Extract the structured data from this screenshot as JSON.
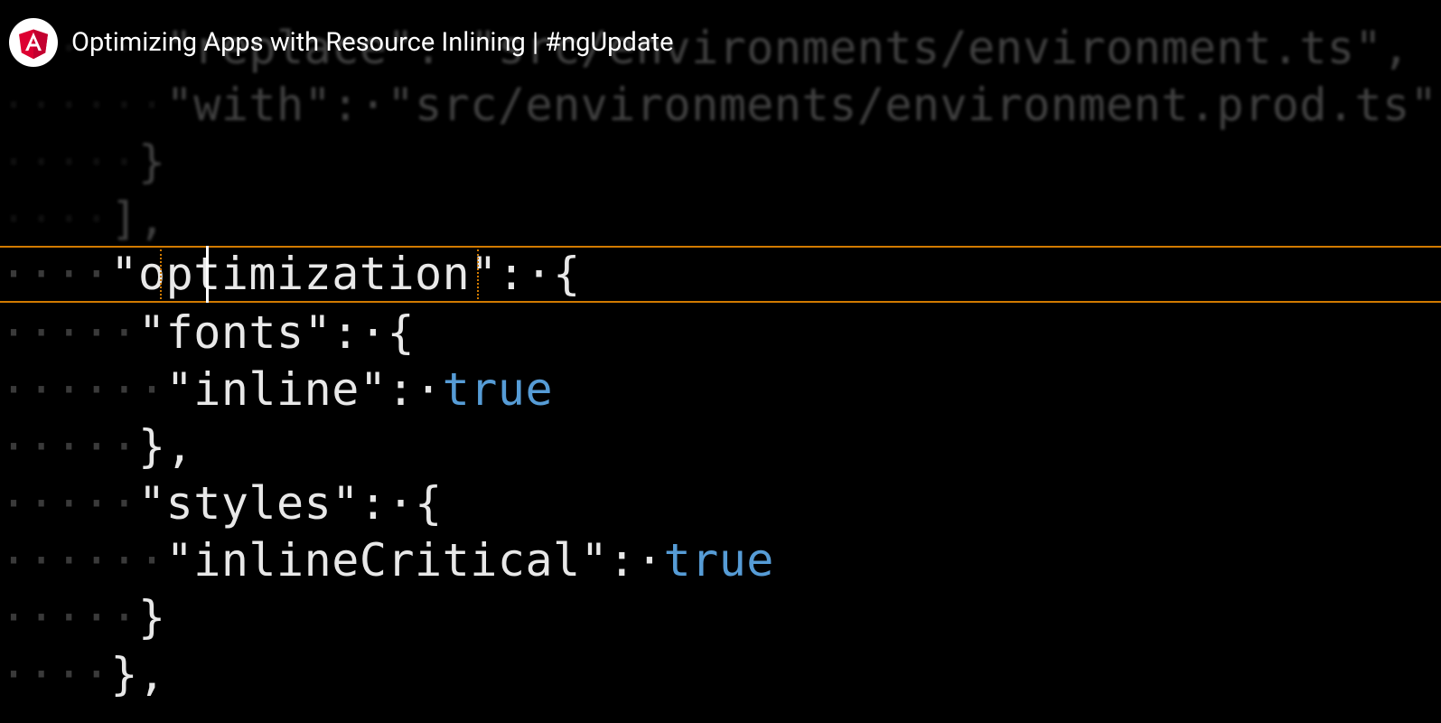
{
  "title": "Optimizing Apps with Resource Inlining | #ngUpdate",
  "colors": {
    "angular_red": "#DD0031",
    "boolean": "#569cd6",
    "highlight_border": "#d17a00"
  },
  "code": {
    "line0": {
      "indent": "······",
      "content": "\"replace\": \"src/environments/environment.ts\","
    },
    "line1": {
      "indent": "······",
      "key": "\"with\"",
      "value": "\"src/environments/environment.prod.ts\""
    },
    "line2": {
      "indent": "·····",
      "content": "}"
    },
    "line3": {
      "indent": "····",
      "content": "],"
    },
    "line4": {
      "indent": "····",
      "key": "\"optimization\"",
      "brace": "{"
    },
    "line5": {
      "indent": "·····",
      "key": "\"fonts\"",
      "brace": "{"
    },
    "line6": {
      "indent": "······",
      "key": "\"inline\"",
      "value": "true"
    },
    "line7": {
      "indent": "·····",
      "content": "},"
    },
    "line8": {
      "indent": "·····",
      "key": "\"styles\"",
      "brace": "{"
    },
    "line9": {
      "indent": "······",
      "key": "\"inlineCritical\"",
      "value": "true"
    },
    "line10": {
      "indent": "·····",
      "content": "}"
    },
    "line11": {
      "indent": "····",
      "content": "},"
    }
  }
}
